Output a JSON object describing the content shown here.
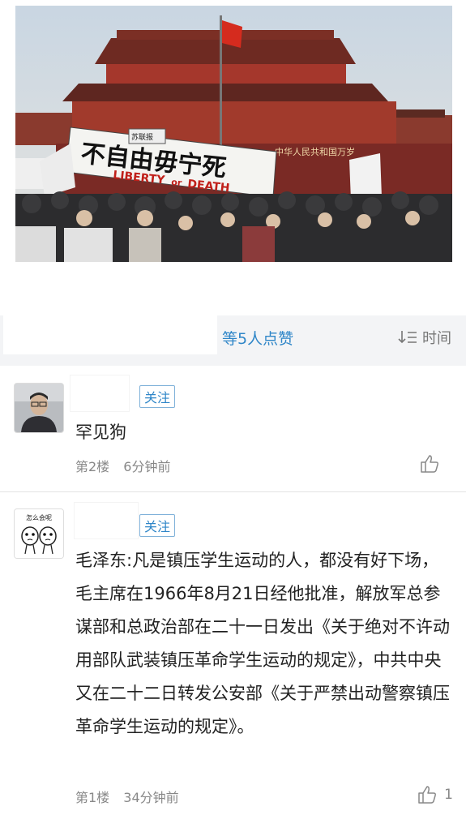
{
  "photo": {
    "banner_cn": "不自由毋宁死",
    "banner_en_1": "LIBERTY",
    "banner_en_2": "or",
    "banner_en_3": "DEATH",
    "gate_sign": "中华人民共和国万岁",
    "small_sign": "苏联报"
  },
  "likes": {
    "text": "等5人点赞",
    "sort_label": "时间"
  },
  "comments": [
    {
      "follow_label": "关注",
      "text": "罕见狗",
      "floor": "第2楼",
      "time": "6分钟前",
      "like_count": ""
    },
    {
      "follow_label": "关注",
      "avatar_caption": "怎么会呢",
      "text": "毛泽东:凡是镇压学生运动的人，都没有好下场，毛主席在1966年8月21日经他批准，解放军总参谋部和总政治部在二十一日发出《关于绝对不许动用部队武装镇压革命学生运动的规定》，中共中央又在二十二日转发公安部《关于严禁出动警察镇压革命学生运动的规定》。",
      "floor": "第1楼",
      "time": "34分钟前",
      "like_count": "1"
    }
  ],
  "colors": {
    "accent": "#2f86c8",
    "muted": "#888888",
    "bar_bg": "#f3f4f6"
  }
}
